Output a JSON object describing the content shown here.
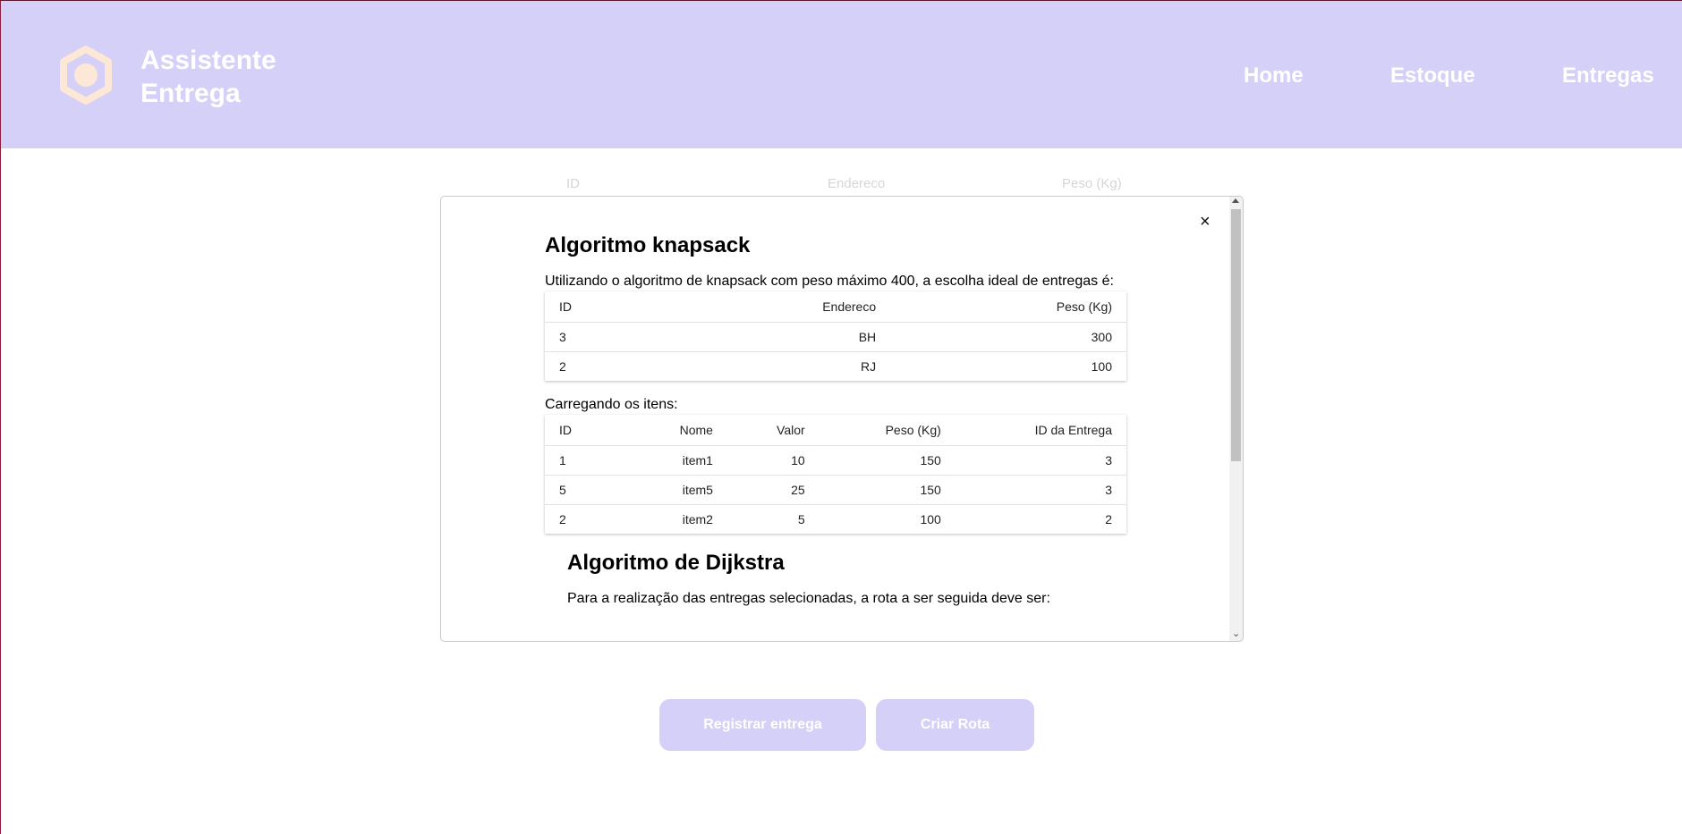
{
  "header": {
    "brand_line1": "Assistente",
    "brand_line2": "Entrega",
    "logo_icon": "hexagon-ring-icon",
    "nav": [
      "Home",
      "Estoque",
      "Entregas"
    ]
  },
  "background_table": {
    "headers": [
      "ID",
      "Endereco",
      "Peso (Kg)"
    ]
  },
  "modal": {
    "close_label": "×",
    "knapsack": {
      "title": "Algoritmo knapsack",
      "description": "Utilizando o algoritmo de knapsack com peso máximo 400, a escolha ideal de entregas é:",
      "headers": [
        "ID",
        "Endereco",
        "Peso (Kg)"
      ],
      "rows": [
        [
          "3",
          "BH",
          "300"
        ],
        [
          "2",
          "RJ",
          "100"
        ]
      ],
      "items_label": "Carregando os itens:",
      "item_headers": [
        "ID",
        "Nome",
        "Valor",
        "Peso (Kg)",
        "ID da Entrega"
      ],
      "item_rows": [
        [
          "1",
          "item1",
          "10",
          "150",
          "3"
        ],
        [
          "5",
          "item5",
          "25",
          "150",
          "3"
        ],
        [
          "2",
          "item2",
          "5",
          "100",
          "2"
        ]
      ]
    },
    "dijkstra": {
      "title": "Algoritmo de Dijkstra",
      "description": "Para a realização das entregas selecionadas, a rota a ser seguida deve ser:"
    }
  },
  "buttons": {
    "register": "Registrar entrega",
    "route": "Criar Rota"
  },
  "colors": {
    "accent": "#d4d0f7",
    "logo": "#fde7d6"
  }
}
